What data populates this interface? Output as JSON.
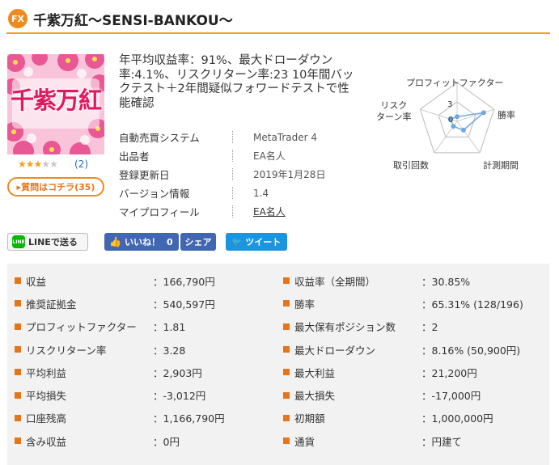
{
  "header": {
    "badge": "FX",
    "title": "千紫万紅〜SENSI-BANKOU〜"
  },
  "thumbnail": {
    "text": "千紫万紅"
  },
  "rating": {
    "stars_filled": 3,
    "stars_total": 5,
    "count": "(2)"
  },
  "question_button": "▸質問はコチラ(35)",
  "summary": "年平均収益率：91%、最大ドローダウン率:4.1%、リスクリターン率:23 10年間バックテスト＋2年間疑似フォワードテストで性能確認",
  "info": [
    {
      "label": "自動売買システム",
      "value": "MetaTrader 4"
    },
    {
      "label": "出品者",
      "value": "EA名人"
    },
    {
      "label": "登録更新日",
      "value": "2019年1月28日"
    },
    {
      "label": "バージョン情報",
      "value": "1.4"
    },
    {
      "label": "マイプロフィール",
      "value": "EA名人"
    }
  ],
  "radar": {
    "labels": {
      "top": "プロフィットファクター",
      "right_upper": "勝率",
      "right_lower": "計測期間",
      "left_lower": "取引回数",
      "left_upper": "リスク\nターン率"
    },
    "scale_outer": "3",
    "scale_inner": "0",
    "values": [
      0.12,
      0.72,
      0.28,
      0.16,
      0.18
    ],
    "color": "#6fa8e0"
  },
  "social": {
    "line": "LINEで送る",
    "like": "いいね！",
    "like_count": "0",
    "share": "シェア",
    "tweet": "ツイート"
  },
  "stats": {
    "left": [
      {
        "label": "収益",
        "value": "：166,790円"
      },
      {
        "label": "推奨証拠金",
        "value": "：540,597円"
      },
      {
        "label": "プロフィットファクター",
        "value": "：1.81"
      },
      {
        "label": "リスクリターン率",
        "value": "：3.28"
      },
      {
        "label": "平均利益",
        "value": "：2,903円"
      },
      {
        "label": "平均損失",
        "value": "：-3,012円"
      },
      {
        "label": "口座残高",
        "value": "：1,166,790円"
      },
      {
        "label": "含み収益",
        "value": "：0円"
      }
    ],
    "right": [
      {
        "label": "収益率（全期間）",
        "value": "：30.85%"
      },
      {
        "label": "勝率",
        "value": "：65.31% (128/196)"
      },
      {
        "label": "最大保有ポジション数",
        "value": "：2"
      },
      {
        "label": "最大ドローダウン",
        "value": "：8.16% (50,900円)"
      },
      {
        "label": "最大利益",
        "value": "：21,200円"
      },
      {
        "label": "最大損失",
        "value": "：-17,000円"
      },
      {
        "label": "初期額",
        "value": "：1,000,000円"
      },
      {
        "label": "通貨",
        "value": "：円建て"
      }
    ]
  },
  "colors": {
    "accent": "#f08a1c",
    "facebook": "#4267b2",
    "twitter": "#1b95e0",
    "line": "#00b900"
  }
}
